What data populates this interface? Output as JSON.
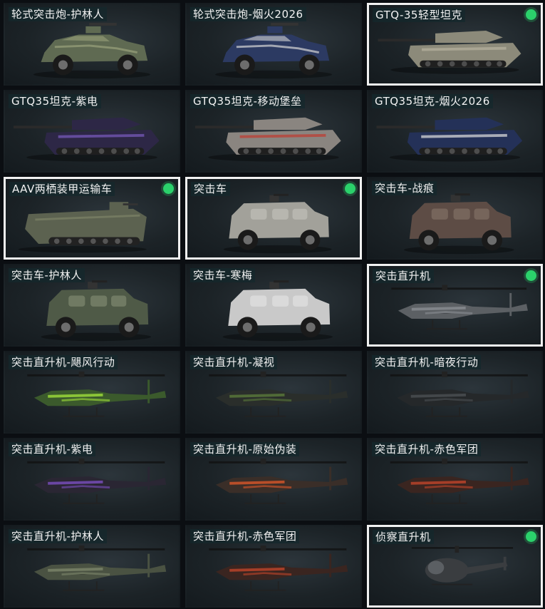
{
  "cards": [
    {
      "label": "轮式突击炮-护林人",
      "type": "car",
      "body": "#5f6a52",
      "accent": "#9aa27c",
      "selected": false
    },
    {
      "label": "轮式突击炮-烟火2026",
      "type": "car",
      "body": "#2c3a62",
      "accent": "#d6d6d6",
      "selected": false
    },
    {
      "label": "GTQ-35轻型坦克",
      "type": "tank",
      "body": "#8c8a7a",
      "accent": "#b7b39f",
      "selected": true
    },
    {
      "label": "GTQ35坦克-紫电",
      "type": "tank",
      "body": "#2d2746",
      "accent": "#7a5cc0",
      "selected": false
    },
    {
      "label": "GTQ35坦克-移动堡垒",
      "type": "tank",
      "body": "#8a8580",
      "accent": "#c13a30",
      "selected": false
    },
    {
      "label": "GTQ35坦克-烟火2026",
      "type": "tank",
      "body": "#243158",
      "accent": "#e0e0e0",
      "selected": false
    },
    {
      "label": "AAV两栖装甲运输车",
      "type": "amph",
      "body": "#5c6250",
      "accent": "#7d8368",
      "selected": true
    },
    {
      "label": "突击车",
      "type": "truck",
      "body": "#a2a19a",
      "accent": "#c9c8c1",
      "selected": true
    },
    {
      "label": "突击车-战痕",
      "type": "truck",
      "body": "#5d4c45",
      "accent": "#8a7a6e",
      "selected": false
    },
    {
      "label": "突击车-护林人",
      "type": "truck",
      "body": "#4f5a47",
      "accent": "#8d957a",
      "selected": false
    },
    {
      "label": "突击车-寒梅",
      "type": "truck",
      "body": "#c9c9c9",
      "accent": "#e8e8e8",
      "selected": false
    },
    {
      "label": "突击直升机",
      "type": "heli",
      "body": "#5c6064",
      "accent": "#8a8e93",
      "selected": true
    },
    {
      "label": "突击直升机-飓风行动",
      "type": "heli",
      "body": "#3b5a2c",
      "accent": "#9fdf3a",
      "selected": false
    },
    {
      "label": "突击直升机-凝视",
      "type": "heli",
      "body": "#2a2e2b",
      "accent": "#5a7a3a",
      "selected": false
    },
    {
      "label": "突击直升机-暗夜行动",
      "type": "heli",
      "body": "#25282a",
      "accent": "#4b4f52",
      "selected": false
    },
    {
      "label": "突击直升机-紫电",
      "type": "heli",
      "body": "#2a2633",
      "accent": "#7b4fc0",
      "selected": false
    },
    {
      "label": "突击直升机-原始伪装",
      "type": "heli",
      "body": "#3a2e28",
      "accent": "#d8562a",
      "selected": false
    },
    {
      "label": "突击直升机-赤色军团",
      "type": "heli",
      "body": "#3a2520",
      "accent": "#c0452a",
      "selected": false
    },
    {
      "label": "突击直升机-护林人",
      "type": "heli",
      "body": "#4a5242",
      "accent": "#7d866b",
      "selected": false
    },
    {
      "label": "突击直升机-赤色军团",
      "type": "heli",
      "body": "#3a2520",
      "accent": "#c0452a",
      "selected": false
    },
    {
      "label": "侦察直升机",
      "type": "scout",
      "body": "#3a3d40",
      "accent": "#6a6e72",
      "selected": true
    }
  ],
  "colors": {
    "selected_border": "#f1f1f1",
    "status_dot": "#2bd16b"
  }
}
